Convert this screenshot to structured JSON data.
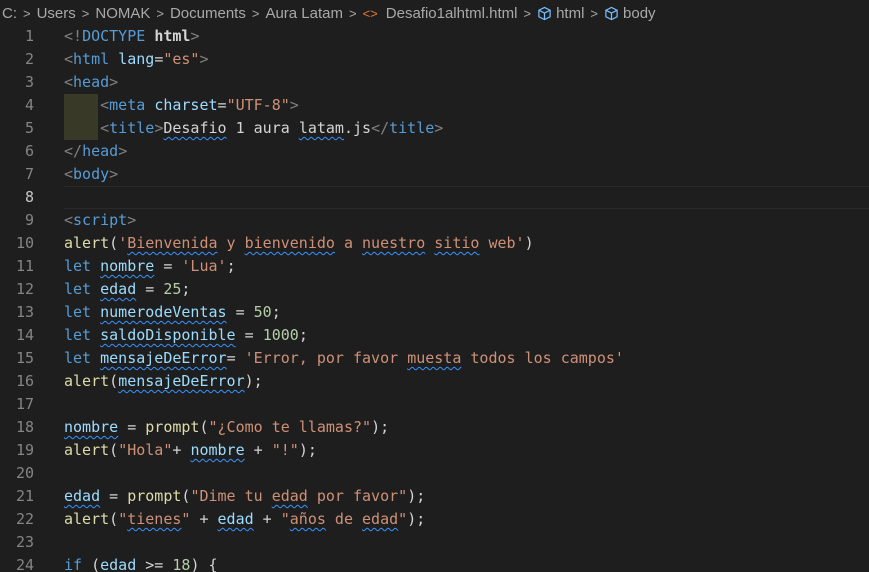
{
  "breadcrumb": {
    "items": [
      "C:",
      "Users",
      "NOMAK",
      "Documents",
      "Aura Latam"
    ],
    "file": "Desafio1alhtml.html",
    "symbols": [
      "html",
      "body"
    ],
    "file_icon": "html-file-icon",
    "symbol_icon": "cube-icon"
  },
  "editor": {
    "current_line": 8,
    "lines": [
      {
        "n": "1",
        "tokens": [
          {
            "t": "<!",
            "c": "t-br"
          },
          {
            "t": "DOCTYPE",
            "c": "t-tag"
          },
          {
            "t": " "
          },
          {
            "t": "html",
            "c": "t-doctype"
          },
          {
            "t": ">",
            "c": "t-br"
          }
        ]
      },
      {
        "n": "2",
        "tokens": [
          {
            "t": "<",
            "c": "t-br"
          },
          {
            "t": "html",
            "c": "t-tag"
          },
          {
            "t": " "
          },
          {
            "t": "lang",
            "c": "t-attr"
          },
          {
            "t": "="
          },
          {
            "t": "\"es\"",
            "c": "t-str"
          },
          {
            "t": ">",
            "c": "t-br"
          }
        ]
      },
      {
        "n": "3",
        "tokens": [
          {
            "t": "<",
            "c": "t-br"
          },
          {
            "t": "head",
            "c": "t-tag"
          },
          {
            "t": ">",
            "c": "t-br"
          }
        ]
      },
      {
        "n": "4",
        "tokens": [
          {
            "t": "    "
          },
          {
            "t": "<",
            "c": "t-br"
          },
          {
            "t": "meta",
            "c": "t-tag"
          },
          {
            "t": " "
          },
          {
            "t": "charset",
            "c": "t-attr"
          },
          {
            "t": "="
          },
          {
            "t": "\"UTF-8\"",
            "c": "t-str"
          },
          {
            "t": ">",
            "c": "t-br"
          }
        ]
      },
      {
        "n": "5",
        "tokens": [
          {
            "t": "    "
          },
          {
            "t": "<",
            "c": "t-br"
          },
          {
            "t": "title",
            "c": "t-tag"
          },
          {
            "t": ">",
            "c": "t-br"
          },
          {
            "t": "Desafio",
            "c": "t-txt",
            "sq": true
          },
          {
            "t": " 1 aura ",
            "c": "t-txt"
          },
          {
            "t": "latam",
            "c": "t-txt",
            "sq": true
          },
          {
            "t": ".js",
            "c": "t-txt"
          },
          {
            "t": "</",
            "c": "t-br"
          },
          {
            "t": "title",
            "c": "t-tag"
          },
          {
            "t": ">",
            "c": "t-br"
          }
        ]
      },
      {
        "n": "6",
        "tokens": [
          {
            "t": "</",
            "c": "t-br"
          },
          {
            "t": "head",
            "c": "t-tag"
          },
          {
            "t": ">",
            "c": "t-br"
          }
        ]
      },
      {
        "n": "7",
        "tokens": [
          {
            "t": "<",
            "c": "t-br"
          },
          {
            "t": "body",
            "c": "t-tag"
          },
          {
            "t": ">",
            "c": "t-br"
          }
        ]
      },
      {
        "n": "8",
        "tokens": []
      },
      {
        "n": "9",
        "tokens": [
          {
            "t": "<",
            "c": "t-br"
          },
          {
            "t": "script",
            "c": "t-tag"
          },
          {
            "t": ">",
            "c": "t-br"
          }
        ]
      },
      {
        "n": "10",
        "tokens": [
          {
            "t": "alert",
            "c": "t-fn"
          },
          {
            "t": "("
          },
          {
            "t": "'",
            "c": "t-str"
          },
          {
            "t": "Bienvenida",
            "c": "t-str",
            "sq": true
          },
          {
            "t": " y ",
            "c": "t-str"
          },
          {
            "t": "bienvenido",
            "c": "t-str",
            "sq": true
          },
          {
            "t": " a ",
            "c": "t-str"
          },
          {
            "t": "nuestro",
            "c": "t-str",
            "sq": true
          },
          {
            "t": " ",
            "c": "t-str"
          },
          {
            "t": "sitio",
            "c": "t-str",
            "sq": true
          },
          {
            "t": " web'",
            "c": "t-str"
          },
          {
            "t": ")"
          }
        ]
      },
      {
        "n": "11",
        "tokens": [
          {
            "t": "let",
            "c": "t-kw"
          },
          {
            "t": " "
          },
          {
            "t": "nombre",
            "c": "t-var",
            "sq": true
          },
          {
            "t": " = "
          },
          {
            "t": "'Lua'",
            "c": "t-str"
          },
          {
            "t": ";"
          }
        ]
      },
      {
        "n": "12",
        "tokens": [
          {
            "t": "let",
            "c": "t-kw"
          },
          {
            "t": " "
          },
          {
            "t": "edad",
            "c": "t-var",
            "sq": true
          },
          {
            "t": " = "
          },
          {
            "t": "25",
            "c": "t-num"
          },
          {
            "t": ";"
          }
        ]
      },
      {
        "n": "13",
        "tokens": [
          {
            "t": "let",
            "c": "t-kw"
          },
          {
            "t": " "
          },
          {
            "t": "numerodeVentas",
            "c": "t-var",
            "sq": true
          },
          {
            "t": " = "
          },
          {
            "t": "50",
            "c": "t-num"
          },
          {
            "t": ";"
          }
        ]
      },
      {
        "n": "14",
        "tokens": [
          {
            "t": "let",
            "c": "t-kw"
          },
          {
            "t": " "
          },
          {
            "t": "saldoDisponible",
            "c": "t-var",
            "sq": true
          },
          {
            "t": " = "
          },
          {
            "t": "1000",
            "c": "t-num"
          },
          {
            "t": ";"
          }
        ]
      },
      {
        "n": "15",
        "tokens": [
          {
            "t": "let",
            "c": "t-kw"
          },
          {
            "t": " "
          },
          {
            "t": "mensajeDeError",
            "c": "t-var",
            "sq": true
          },
          {
            "t": "= "
          },
          {
            "t": "'Error, por favor ",
            "c": "t-str"
          },
          {
            "t": "muesta",
            "c": "t-str",
            "sq": true
          },
          {
            "t": " todos los campos'",
            "c": "t-str"
          }
        ]
      },
      {
        "n": "16",
        "tokens": [
          {
            "t": "alert",
            "c": "t-fn"
          },
          {
            "t": "("
          },
          {
            "t": "mensajeDeError",
            "c": "t-var",
            "sq": true
          },
          {
            "t": ");"
          }
        ]
      },
      {
        "n": "17",
        "tokens": []
      },
      {
        "n": "18",
        "tokens": [
          {
            "t": "nombre",
            "c": "t-var",
            "sq": true
          },
          {
            "t": " = "
          },
          {
            "t": "prompt",
            "c": "t-fn"
          },
          {
            "t": "("
          },
          {
            "t": "\"¿Como te llamas?\"",
            "c": "t-str"
          },
          {
            "t": ");"
          }
        ]
      },
      {
        "n": "19",
        "tokens": [
          {
            "t": "alert",
            "c": "t-fn"
          },
          {
            "t": "("
          },
          {
            "t": "\"Hola\"",
            "c": "t-str"
          },
          {
            "t": "+ "
          },
          {
            "t": "nombre",
            "c": "t-var",
            "sq": true
          },
          {
            "t": " + "
          },
          {
            "t": "\"!\"",
            "c": "t-str"
          },
          {
            "t": ");"
          }
        ]
      },
      {
        "n": "20",
        "tokens": []
      },
      {
        "n": "21",
        "tokens": [
          {
            "t": "edad",
            "c": "t-var",
            "sq": true
          },
          {
            "t": " = "
          },
          {
            "t": "prompt",
            "c": "t-fn"
          },
          {
            "t": "("
          },
          {
            "t": "\"Dime tu ",
            "c": "t-str"
          },
          {
            "t": "edad",
            "c": "t-str",
            "sq": true
          },
          {
            "t": " por favor\"",
            "c": "t-str"
          },
          {
            "t": ");"
          }
        ]
      },
      {
        "n": "22",
        "tokens": [
          {
            "t": "alert",
            "c": "t-fn"
          },
          {
            "t": "("
          },
          {
            "t": "\"",
            "c": "t-str"
          },
          {
            "t": "tienes",
            "c": "t-str",
            "sq": true
          },
          {
            "t": "\"",
            "c": "t-str"
          },
          {
            "t": " + "
          },
          {
            "t": "edad",
            "c": "t-var",
            "sq": true
          },
          {
            "t": " + "
          },
          {
            "t": "\"",
            "c": "t-str"
          },
          {
            "t": "años",
            "c": "t-str",
            "sq": true
          },
          {
            "t": " de ",
            "c": "t-str"
          },
          {
            "t": "edad",
            "c": "t-str",
            "sq": true
          },
          {
            "t": "\"",
            "c": "t-str"
          },
          {
            "t": ");"
          }
        ]
      },
      {
        "n": "23",
        "tokens": []
      },
      {
        "n": "24",
        "tokens": [
          {
            "t": "if",
            "c": "t-kw"
          },
          {
            "t": " ("
          },
          {
            "t": "edad",
            "c": "t-var",
            "sq": true
          },
          {
            "t": " >= "
          },
          {
            "t": "18",
            "c": "t-num"
          },
          {
            "t": ") {"
          }
        ]
      }
    ]
  }
}
